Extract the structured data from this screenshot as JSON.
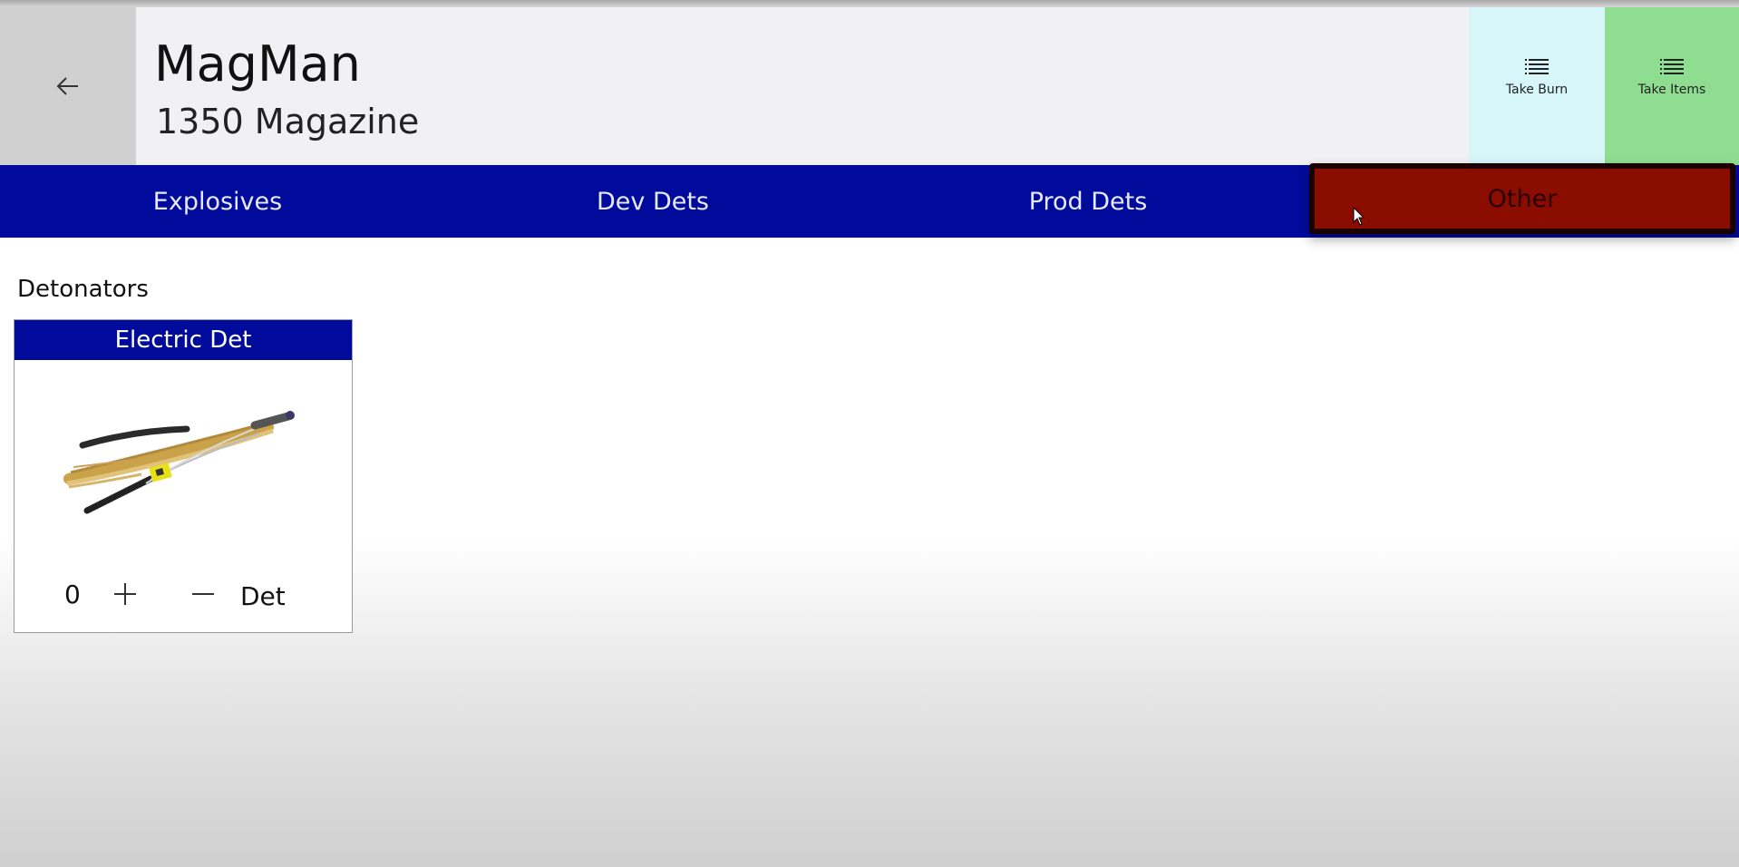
{
  "header": {
    "title": "MagMan",
    "subtitle": "1350 Magazine",
    "back_icon": "back-arrow-icon"
  },
  "actions": {
    "take_burn": {
      "label": "Take Burn",
      "icon": "list-icon",
      "color": "#d6f6fa"
    },
    "take_items": {
      "label": "Take Items",
      "icon": "list-icon",
      "color": "#8fdd90"
    }
  },
  "tabs": [
    {
      "label": "Explosives"
    },
    {
      "label": "Dev Dets"
    },
    {
      "label": "Prod Dets"
    },
    {
      "label": "Other",
      "selected": true,
      "color": "#8a0d00"
    }
  ],
  "colors": {
    "tabbar": "#000b9c",
    "selected_tab": "#8a0d00"
  },
  "section": {
    "label": "Detonators"
  },
  "items": [
    {
      "title": "Electric Det",
      "image": "electric-detonator-image",
      "quantity": "0",
      "unit": "Det"
    }
  ]
}
